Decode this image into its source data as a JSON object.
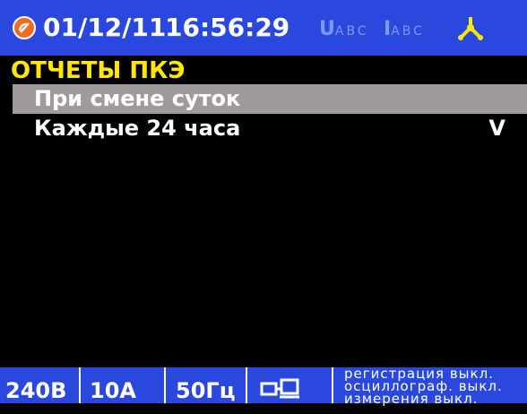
{
  "header": {
    "date": "01/12/11",
    "time": "16:56:29",
    "voltage_label": "U",
    "voltage_phases": "ABC",
    "current_label": "I",
    "current_phases": "ABC",
    "logo_icon": "brand-logo-icon",
    "phase_icon": "three-phase-icon"
  },
  "section": {
    "title": "ОТЧЕТЫ ПКЭ"
  },
  "menu": {
    "items": [
      {
        "label": "При смене суток",
        "mark": ""
      },
      {
        "label": "Каждые 24 часа",
        "mark": "V"
      }
    ]
  },
  "status_bar": {
    "voltage": "240В",
    "current": "10А",
    "frequency": "50Гц",
    "network_icon": "network-computers-icon",
    "messages": [
      "регистрация выкл.",
      "осциллограф. выкл.",
      "измерения выкл."
    ]
  },
  "colors": {
    "bar_blue": "#2b48de",
    "title_yellow": "#ffe800",
    "selection_gray": "#a19a9c",
    "phase_icon_yellow": "#ffe800",
    "logo_orange": "#f26b21"
  }
}
